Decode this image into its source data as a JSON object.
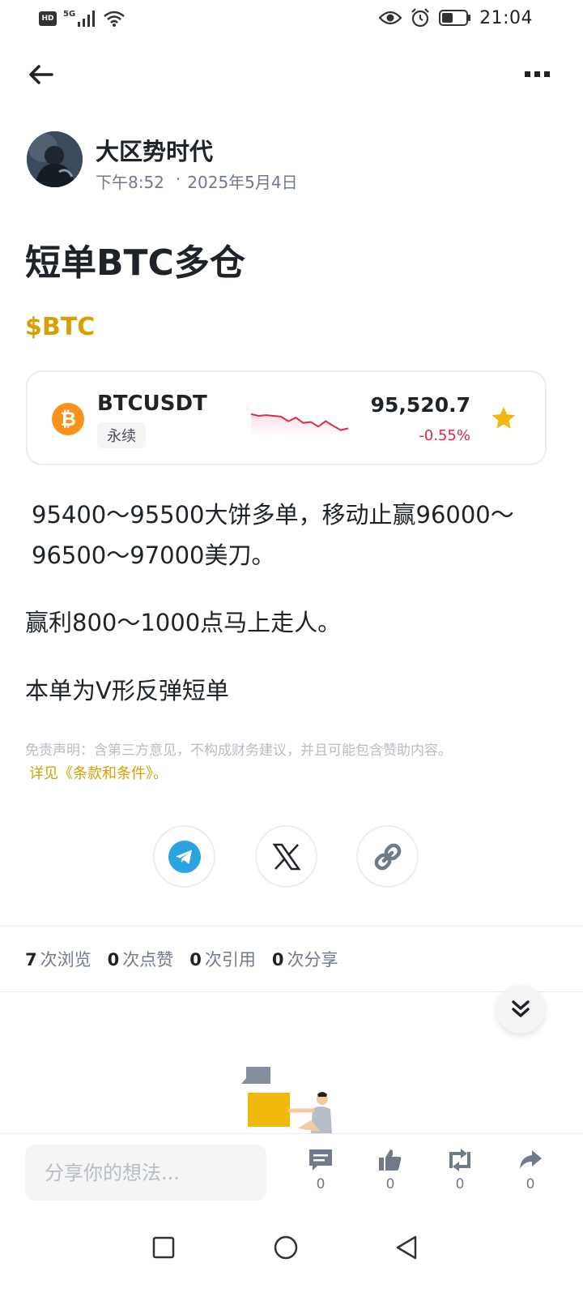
{
  "status_bar": {
    "hd": "HD",
    "network": "5G",
    "time": "21:04"
  },
  "author": {
    "name": "大区势时代",
    "time": "下午8:52",
    "separator": "·",
    "date": "2025年5月4日"
  },
  "post": {
    "title": "短单BTC多仓",
    "ticker": "$BTC",
    "paragraphs": [
      "95400～95500大饼多单，移动止赢96000～96500～97000美刀。",
      "赢利800～1000点马上走人。",
      "本单为V形反弹短单"
    ],
    "disclaimer": "免责声明：含第三方意见，不构成财务建议，并且可能包含赞助内容。",
    "terms_link": "详见《条款和条件》。"
  },
  "coin_card": {
    "logo": "₿",
    "pair": "BTCUSDT",
    "type": "永续",
    "price": "95,520.7",
    "change": "-0.55%",
    "change_color": "#e0294a",
    "star_color": "#f0b90b",
    "sparkline_trend": [
      0.55,
      0.5,
      0.52,
      0.5,
      0.48,
      0.35,
      0.45,
      0.3,
      0.33,
      0.2,
      0.35,
      0.22,
      0.1,
      0.15
    ]
  },
  "share": {
    "buttons": [
      "telegram-icon",
      "x-logo-icon",
      "link-icon"
    ]
  },
  "stats": [
    {
      "value": "7",
      "label": "次浏览"
    },
    {
      "value": "0",
      "label": "次点赞"
    },
    {
      "value": "0",
      "label": "次引用"
    },
    {
      "value": "0",
      "label": "次分享"
    }
  ],
  "comment_bar": {
    "placeholder": "分享你的想法...",
    "actions": [
      {
        "icon": "comment-icon",
        "count": "0"
      },
      {
        "icon": "like-icon",
        "count": "0"
      },
      {
        "icon": "repost-icon",
        "count": "0"
      },
      {
        "icon": "share-icon",
        "count": "0"
      }
    ]
  },
  "colors": {
    "brand_yellow": "#d89f00",
    "text_primary": "#1e2329",
    "text_secondary": "#707a8a"
  }
}
